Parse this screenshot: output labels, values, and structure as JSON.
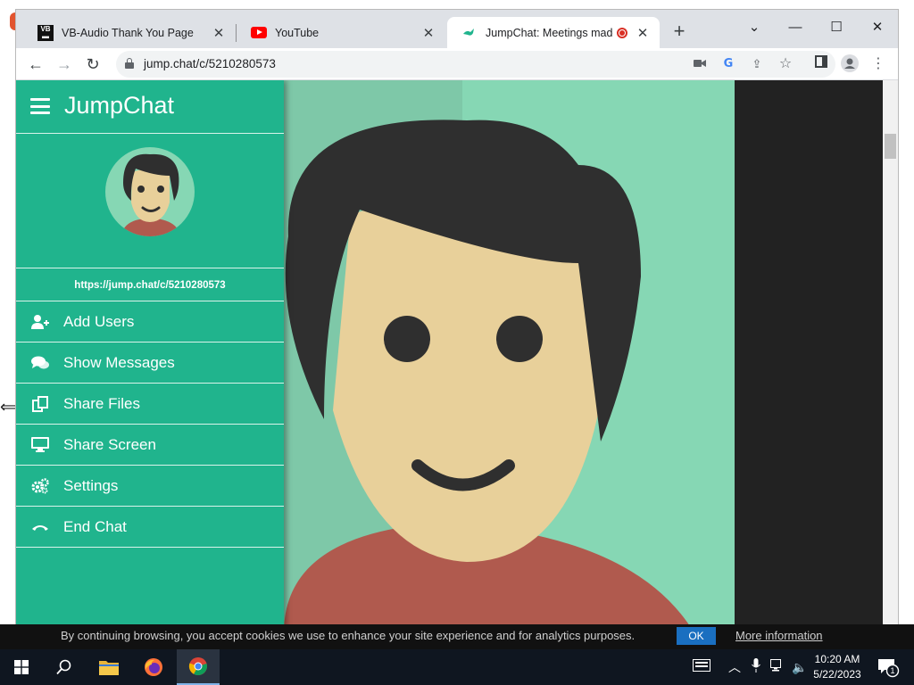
{
  "browser": {
    "tabs": [
      {
        "title": "VB-Audio Thank You Page",
        "favicon": "vb-audio-icon",
        "active": false
      },
      {
        "title": "YouTube",
        "favicon": "youtube-icon",
        "active": false
      },
      {
        "title": "JumpChat: Meetings made e",
        "favicon": "jumpchat-icon",
        "active": true,
        "recording": true
      }
    ],
    "new_tab_label": "+",
    "address": "jump.chat/c/5210280573"
  },
  "sidebar": {
    "brand": "JumpChat",
    "room_link": "https://jump.chat/c/5210280573",
    "items": [
      {
        "label": "Add Users",
        "icon": "add-user-icon"
      },
      {
        "label": "Show Messages",
        "icon": "chat-bubbles-icon"
      },
      {
        "label": "Share Files",
        "icon": "files-icon"
      },
      {
        "label": "Share Screen",
        "icon": "monitor-icon"
      },
      {
        "label": "Settings",
        "icon": "gears-icon"
      },
      {
        "label": "End Chat",
        "icon": "hang-up-icon"
      }
    ]
  },
  "cookie_bar": {
    "text": "By continuing browsing, you accept cookies we use to enhance your site experience and for analytics purposes.",
    "ok_label": "OK",
    "more_label": "More information"
  },
  "taskbar": {
    "time": "10:20 AM",
    "date": "5/22/2023",
    "notification_count": "1"
  },
  "colors": {
    "sidebar": "#20b48d",
    "video_bg": "#86d7b4",
    "skin": "#e8d09a",
    "hair": "#2f2f2f",
    "shirt": "#b05a4e"
  }
}
